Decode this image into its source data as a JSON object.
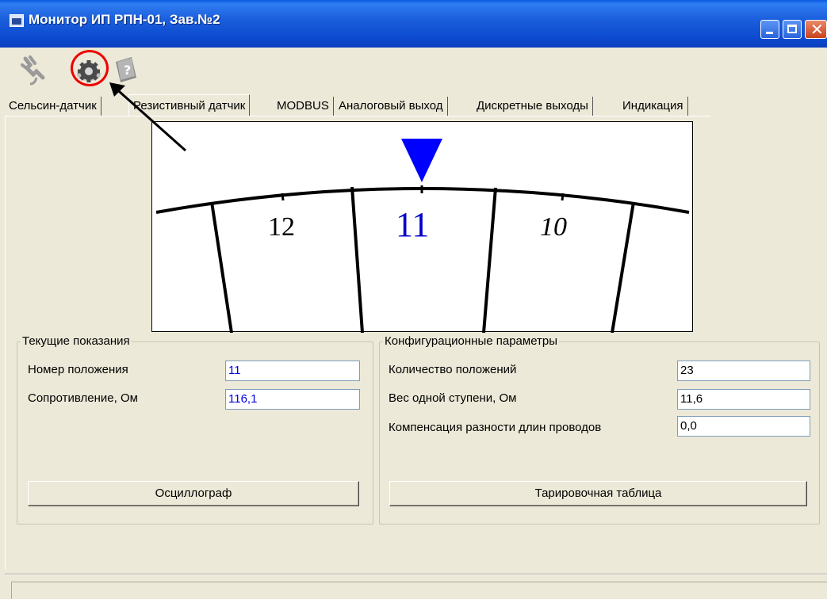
{
  "window": {
    "title": "Монитор ИП РПН-01, Зав.№2"
  },
  "toolbar": {
    "icons": [
      "plug-icon",
      "gear-icon",
      "help-book-icon"
    ]
  },
  "tabs": [
    {
      "label": "Сельсин-датчик",
      "active": false
    },
    {
      "label": "Резистивный датчик",
      "active": true
    },
    {
      "label": "MODBUS",
      "active": false
    },
    {
      "label": "Аналоговый выход",
      "active": false
    },
    {
      "label": "Дискретные выходы",
      "active": false
    },
    {
      "label": "Индикация",
      "active": false
    }
  ],
  "dial": {
    "left_label": "12",
    "current_label": "11",
    "right_label": "10",
    "current_color": "#0000cc",
    "marker_color": "#0000ff"
  },
  "current_readings": {
    "title": "Текущие показания",
    "position_label": "Номер положения",
    "position_value": "11",
    "resistance_label": "Сопротивление, Ом",
    "resistance_value": "116,1",
    "oscilloscope_button": "Осциллограф"
  },
  "config": {
    "title": "Конфигурационные параметры",
    "positions_count_label": "Количество положений",
    "positions_count_value": "23",
    "step_weight_label": "Вес одной ступени, Ом",
    "step_weight_value": "11,6",
    "wire_comp_label": "Компенсация разности длин проводов",
    "wire_comp_value": "0,0",
    "calibration_button": "Тарировочная таблица"
  },
  "colors": {
    "titlebar": "#0c4ad0",
    "highlight_circle": "#ee0000",
    "value_text": "#0000dd"
  }
}
